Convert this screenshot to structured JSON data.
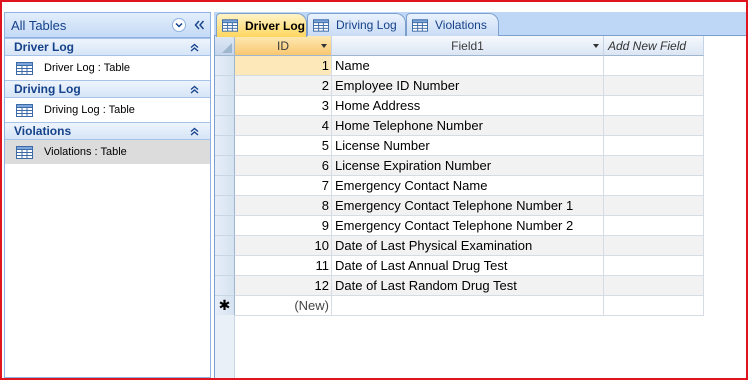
{
  "nav": {
    "title": "All Tables",
    "groups": [
      {
        "title": "Driver Log",
        "item": "Driver Log : Table",
        "selected": false
      },
      {
        "title": "Driving Log",
        "item": "Driving Log : Table",
        "selected": false
      },
      {
        "title": "Violations",
        "item": "Violations : Table",
        "selected": true
      }
    ]
  },
  "tabs": [
    {
      "label": "Driver Log",
      "active": true
    },
    {
      "label": "Driving Log",
      "active": false
    },
    {
      "label": "Violations",
      "active": false
    }
  ],
  "table": {
    "columns": [
      "ID",
      "Field1",
      "Add New Field"
    ],
    "rows": [
      {
        "id": "1",
        "field1": "Name"
      },
      {
        "id": "2",
        "field1": "Employee ID Number"
      },
      {
        "id": "3",
        "field1": "Home Address"
      },
      {
        "id": "4",
        "field1": "Home Telephone Number"
      },
      {
        "id": "5",
        "field1": "License Number"
      },
      {
        "id": "6",
        "field1": "License Expiration Number"
      },
      {
        "id": "7",
        "field1": "Emergency Contact Name"
      },
      {
        "id": "8",
        "field1": "Emergency Contact Telephone Number 1"
      },
      {
        "id": "9",
        "field1": "Emergency Contact Telephone Number 2"
      },
      {
        "id": "10",
        "field1": "Date of Last Physical Examination"
      },
      {
        "id": "11",
        "field1": "Date of Last Annual Drug Test"
      },
      {
        "id": "12",
        "field1": "Date of Last Random Drug Test"
      }
    ],
    "new_row_marker": "✱",
    "new_row_label": "(New)"
  },
  "icons": {
    "nav_dropdown": "chevron-down-icon",
    "nav_collapse": "double-chevron-left-icon",
    "group_collapse": "double-chevron-up-icon",
    "table": "table-icon"
  },
  "colors": {
    "frame": "#e0141e",
    "accent_blue": "#15428b",
    "active_tab": "#ffd65f"
  }
}
